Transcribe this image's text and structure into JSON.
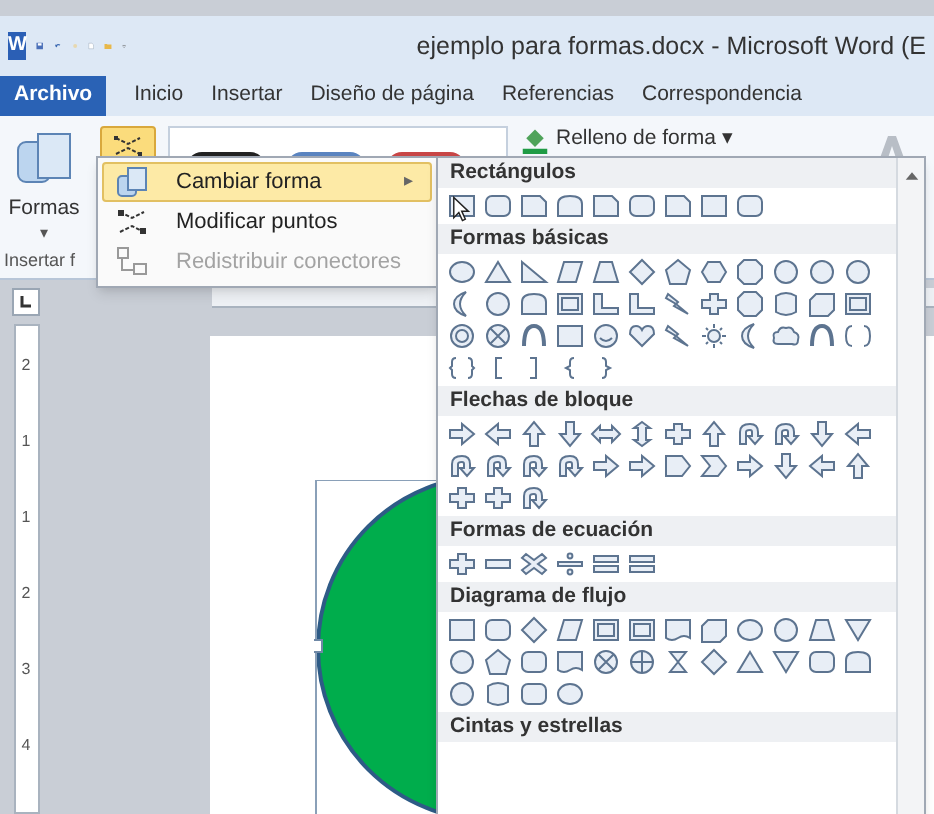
{
  "title_bar": {
    "app_letter": "W",
    "title": "ejemplo para formas.docx - Microsoft Word (E"
  },
  "tabs": [
    {
      "label": "Archivo",
      "selected": true
    },
    {
      "label": "Inicio",
      "selected": false
    },
    {
      "label": "Insertar",
      "selected": false
    },
    {
      "label": "Diseño de página",
      "selected": false
    },
    {
      "label": "Referencias",
      "selected": false
    },
    {
      "label": "Correspondencia",
      "selected": false
    }
  ],
  "ribbon": {
    "shapes_button": {
      "label": "Formas",
      "caret": "▾"
    },
    "edit_shape_button": {
      "selected": true
    },
    "shape_fill": {
      "label": "Relleno de forma",
      "caret": "▾"
    },
    "group_label": "Insertar f"
  },
  "shape_menu": {
    "items": [
      {
        "label": "Cambiar forma",
        "selected": true,
        "disabled": false,
        "submenu_arrow": "▸"
      },
      {
        "label": "Modificar puntos",
        "selected": false,
        "disabled": false
      },
      {
        "label": "Redistribuir conectores",
        "selected": false,
        "disabled": true
      }
    ]
  },
  "shapes_gallery": {
    "sections": [
      {
        "title": "Rectángulos"
      },
      {
        "title": "Formas básicas"
      },
      {
        "title": "Flechas de bloque"
      },
      {
        "title": "Formas de ecuación"
      },
      {
        "title": "Diagrama de flujo"
      },
      {
        "title": "Cintas y estrellas"
      }
    ]
  },
  "vertical_ruler": {
    "labels": [
      "2",
      "1",
      "1",
      "2",
      "3",
      "4"
    ]
  }
}
